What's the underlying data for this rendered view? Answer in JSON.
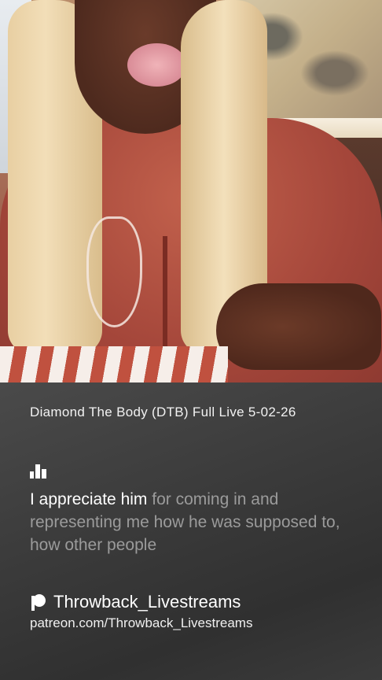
{
  "video": {
    "description_icon": "video-frame"
  },
  "stream": {
    "title": "Diamond The Body (DTB) Full Live 5-02-26"
  },
  "transcript": {
    "icon": "bar-chart-icon",
    "spoken": "I appreciate him",
    "upcoming": " for coming in and representing me how he was supposed to, how other people"
  },
  "creator": {
    "icon": "patreon-icon",
    "name": "Throwback_Livestreams",
    "url": "patreon.com/Throwback_Livestreams"
  },
  "colors": {
    "panel_bg": "#3a3a3a",
    "highlight_text": "#ffffff",
    "dim_text": "#9b9b9b"
  }
}
